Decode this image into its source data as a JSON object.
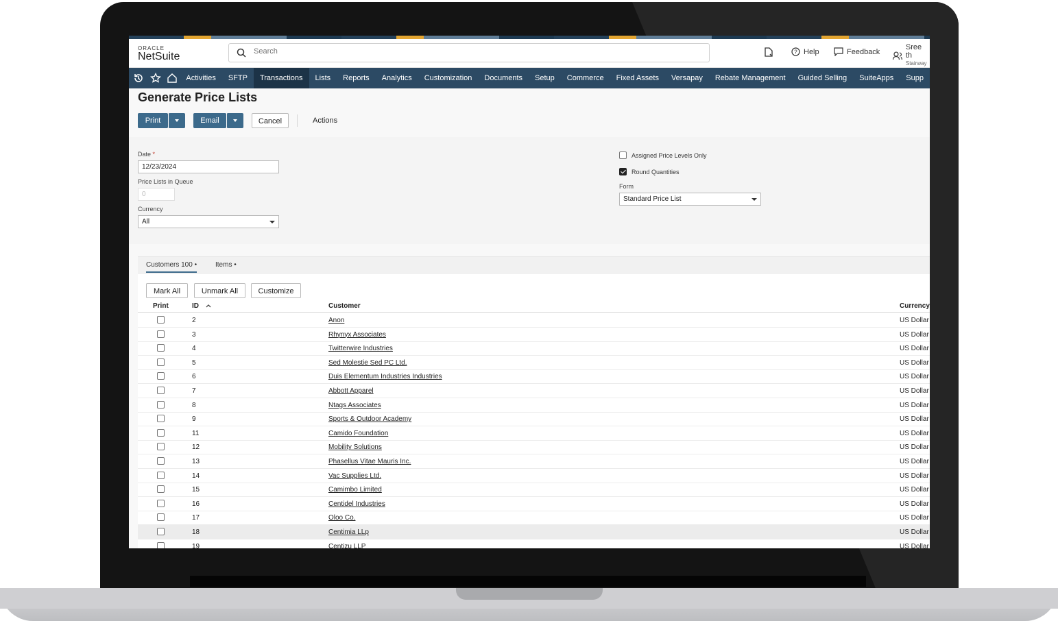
{
  "app": {
    "logo_top": "ORACLE",
    "logo_main": "NetSuite",
    "search_placeholder": "Search",
    "help": "Help",
    "feedback": "Feedback",
    "user_name": "Sree th",
    "user_sub": "Stairway"
  },
  "nav": {
    "items": [
      "Activities",
      "SFTP",
      "Transactions",
      "Lists",
      "Reports",
      "Analytics",
      "Customization",
      "Documents",
      "Setup",
      "Commerce",
      "Fixed Assets",
      "Versapay",
      "Rebate Management",
      "Guided Selling",
      "SuiteApps",
      "Supp"
    ],
    "active": "Transactions"
  },
  "page": {
    "title": "Generate Price Lists",
    "print": "Print",
    "email": "Email",
    "cancel": "Cancel",
    "actions": "Actions"
  },
  "form": {
    "date_label": "Date",
    "date_required": "*",
    "date_value": "12/23/2024",
    "queue_label": "Price Lists in Queue",
    "queue_value": "0",
    "currency_label": "Currency",
    "currency_value": "All",
    "assigned_label": "Assigned Price Levels Only",
    "assigned_checked": false,
    "round_label": "Round Quantities",
    "round_checked": true,
    "form_label": "Form",
    "form_value": "Standard Price List"
  },
  "tabs": {
    "customers": "Customers 100 •",
    "items": "Items •"
  },
  "sublist": {
    "mark_all": "Mark All",
    "unmark_all": "Unmark All",
    "customize": "Customize",
    "headers": {
      "print": "Print",
      "id": "ID",
      "customer": "Customer",
      "currency": "Currency"
    },
    "rows": [
      {
        "id": "2",
        "customer": "Anon",
        "currency": "US Dollar"
      },
      {
        "id": "3",
        "customer": "Rhynyx Associates",
        "currency": "US Dollar"
      },
      {
        "id": "4",
        "customer": "Twitterwire Industries",
        "currency": "US Dollar"
      },
      {
        "id": "5",
        "customer": "Sed Molestie Sed PC Ltd.",
        "currency": "US Dollar"
      },
      {
        "id": "6",
        "customer": "Duis Elementum Industries Industries",
        "currency": "US Dollar"
      },
      {
        "id": "7",
        "customer": "Abbott Apparel",
        "currency": "US Dollar"
      },
      {
        "id": "8",
        "customer": "Ntags Associates",
        "currency": "US Dollar"
      },
      {
        "id": "9",
        "customer": "Sports & Outdoor Academy",
        "currency": "US Dollar"
      },
      {
        "id": "11",
        "customer": "Camido Foundation",
        "currency": "US Dollar"
      },
      {
        "id": "12",
        "customer": "Mobility Solutions",
        "currency": "US Dollar"
      },
      {
        "id": "13",
        "customer": "Phasellus Vitae Mauris Inc.",
        "currency": "US Dollar"
      },
      {
        "id": "14",
        "customer": "Vac Supplies Ltd.",
        "currency": "US Dollar"
      },
      {
        "id": "15",
        "customer": "Camimbo Limited",
        "currency": "US Dollar"
      },
      {
        "id": "16",
        "customer": "Centidel Industries",
        "currency": "US Dollar"
      },
      {
        "id": "17",
        "customer": "Oloo Co.",
        "currency": "US Dollar"
      },
      {
        "id": "18",
        "customer": "Centimia LLp",
        "currency": "US Dollar"
      },
      {
        "id": "19",
        "customer": "Centizu LLP",
        "currency": "US Dollar"
      }
    ]
  }
}
